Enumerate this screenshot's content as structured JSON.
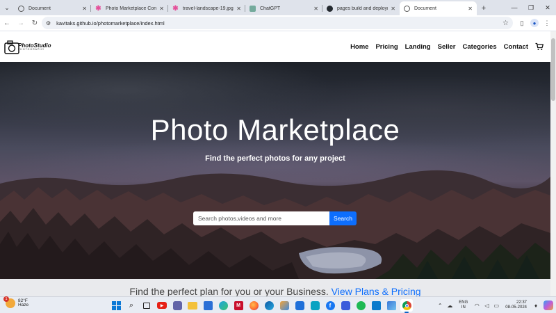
{
  "browser": {
    "tabs": [
      {
        "title": "Document",
        "favicon": "globe-icon",
        "active": false
      },
      {
        "title": "Photo Marketplace Contac",
        "favicon": "asterisk-icon",
        "active": false
      },
      {
        "title": "travel-landscape-19.jpg (1",
        "favicon": "asterisk-icon",
        "active": false
      },
      {
        "title": "ChatGPT",
        "favicon": "chatgpt-icon",
        "active": false
      },
      {
        "title": "pages build and deployme",
        "favicon": "github-icon",
        "active": false
      },
      {
        "title": "Document",
        "favicon": "globe-icon",
        "active": true
      }
    ],
    "url": "kavitaks.github.io/photomarketplace/index.html"
  },
  "site": {
    "logo": {
      "name": "PhotoStudio",
      "tagline": "PHOTOGRAPHY"
    },
    "nav": [
      "Home",
      "Pricing",
      "Landing",
      "Seller",
      "Categories",
      "Contact"
    ],
    "hero": {
      "title": "Photo Marketplace",
      "subtitle": "Find the perfect photos for any project",
      "search_placeholder": "Search photos,videos and more",
      "search_button": "Search"
    },
    "plans": {
      "text": "Find the perfect plan for you or your Business.",
      "link": "View Plans & Pricing"
    }
  },
  "taskbar": {
    "weather": {
      "temp": "82°F",
      "condition": "Haze",
      "badge": "1"
    },
    "language": {
      "top": "ENG",
      "bottom": "IN"
    },
    "clock": {
      "time": "22:37",
      "date": "08-05-2024"
    }
  },
  "colors": {
    "accent": "#0d6efd",
    "tab_strip": "#dfe3eb"
  }
}
